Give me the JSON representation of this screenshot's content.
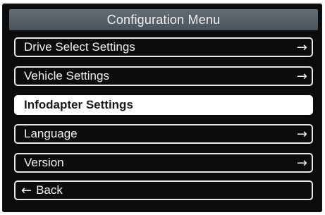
{
  "title": "Configuration Menu",
  "menu": {
    "items": [
      {
        "label": "Drive Select Settings",
        "icon": "right-arrow-icon",
        "glyph": "→"
      },
      {
        "label": "Vehicle Settings",
        "icon": "right-arrow-icon",
        "glyph": "→"
      },
      {
        "label": "Infodapter Settings",
        "selected": true
      },
      {
        "label": "Language",
        "icon": "right-arrow-icon",
        "glyph": "→"
      },
      {
        "label": "Version",
        "icon": "right-arrow-icon",
        "glyph": "→"
      }
    ],
    "back": {
      "label": "Back",
      "icon": "left-arrow-icon",
      "glyph": "←"
    }
  },
  "colors": {
    "background": "#0b0c0d",
    "title_bar": "#5a6268",
    "item_border": "#e8e8e8",
    "selected_fill": "#ffffff"
  }
}
